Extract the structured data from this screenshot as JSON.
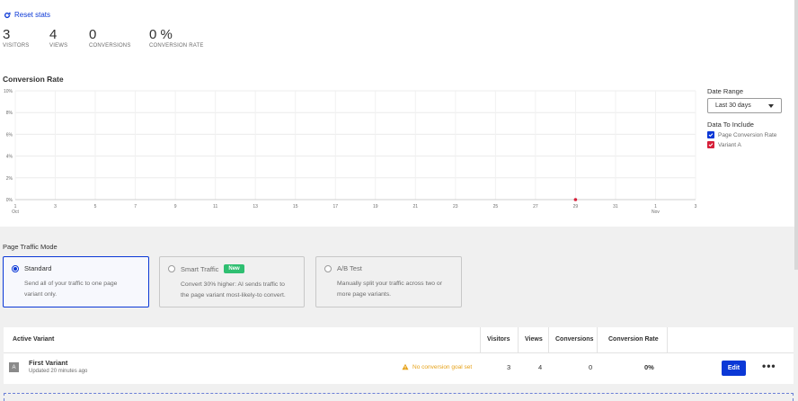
{
  "reset_label": "Reset stats",
  "stats": [
    {
      "value": "3",
      "label": "VISITORS"
    },
    {
      "value": "4",
      "label": "VIEWS"
    },
    {
      "value": "0",
      "label": "CONVERSIONS"
    },
    {
      "value": "0 %",
      "label": "CONVERSION RATE"
    }
  ],
  "chart_title": "Conversion Rate",
  "chart_data": {
    "type": "line",
    "title": "Conversion Rate",
    "y_ticks": [
      "10%",
      "8%",
      "6%",
      "4%",
      "2%",
      "0%"
    ],
    "ylim": [
      0,
      10
    ],
    "x_ticks": [
      "1",
      "3",
      "5",
      "7",
      "9",
      "11",
      "13",
      "15",
      "17",
      "19",
      "21",
      "23",
      "25",
      "27",
      "29",
      "31",
      "1",
      "3"
    ],
    "x_month_labels": [
      {
        "tick_index": 0,
        "label": "Oct"
      },
      {
        "tick_index": 16,
        "label": "Nov"
      }
    ],
    "grid": true,
    "series": [
      {
        "name": "Page Conversion Rate",
        "color": "#0b38d6",
        "points": []
      },
      {
        "name": "Variant A",
        "color": "#d6203a",
        "points": [
          {
            "x": "29",
            "y": 0
          }
        ]
      }
    ]
  },
  "sidebar": {
    "date_range_label": "Date Range",
    "date_range_value": "Last 30 days",
    "data_label": "Data To Include",
    "checkboxes": [
      {
        "label": "Page Conversion Rate",
        "color": "#0b38d6"
      },
      {
        "label": "Variant A",
        "color": "#d6203a"
      }
    ]
  },
  "traffic": {
    "label": "Page Traffic Mode",
    "options": [
      {
        "title": "Standard",
        "desc1": "Send all of your traffic to one page",
        "desc2": "variant only.",
        "selected": true
      },
      {
        "title": "Smart Traffic",
        "badge": "New",
        "desc1": "Convert 30% higher: AI sends traffic to",
        "desc2": "the page variant most-likely-to convert.",
        "selected": false
      },
      {
        "title": "A/B Test",
        "desc1": "Manually split your traffic across two or",
        "desc2": "more page variants.",
        "selected": false
      }
    ]
  },
  "table": {
    "headers": {
      "variant": "Active Variant",
      "visitors": "Visitors",
      "views": "Views",
      "conversions": "Conversions",
      "rate": "Conversion Rate"
    },
    "row": {
      "thumb": "A",
      "name": "First Variant",
      "updated": "Updated 20 minutes ago",
      "warning": "No conversion goal set",
      "visitors": "3",
      "views": "4",
      "conversions": "0",
      "rate": "0%",
      "edit_label": "Edit",
      "more_label": "•••"
    }
  }
}
